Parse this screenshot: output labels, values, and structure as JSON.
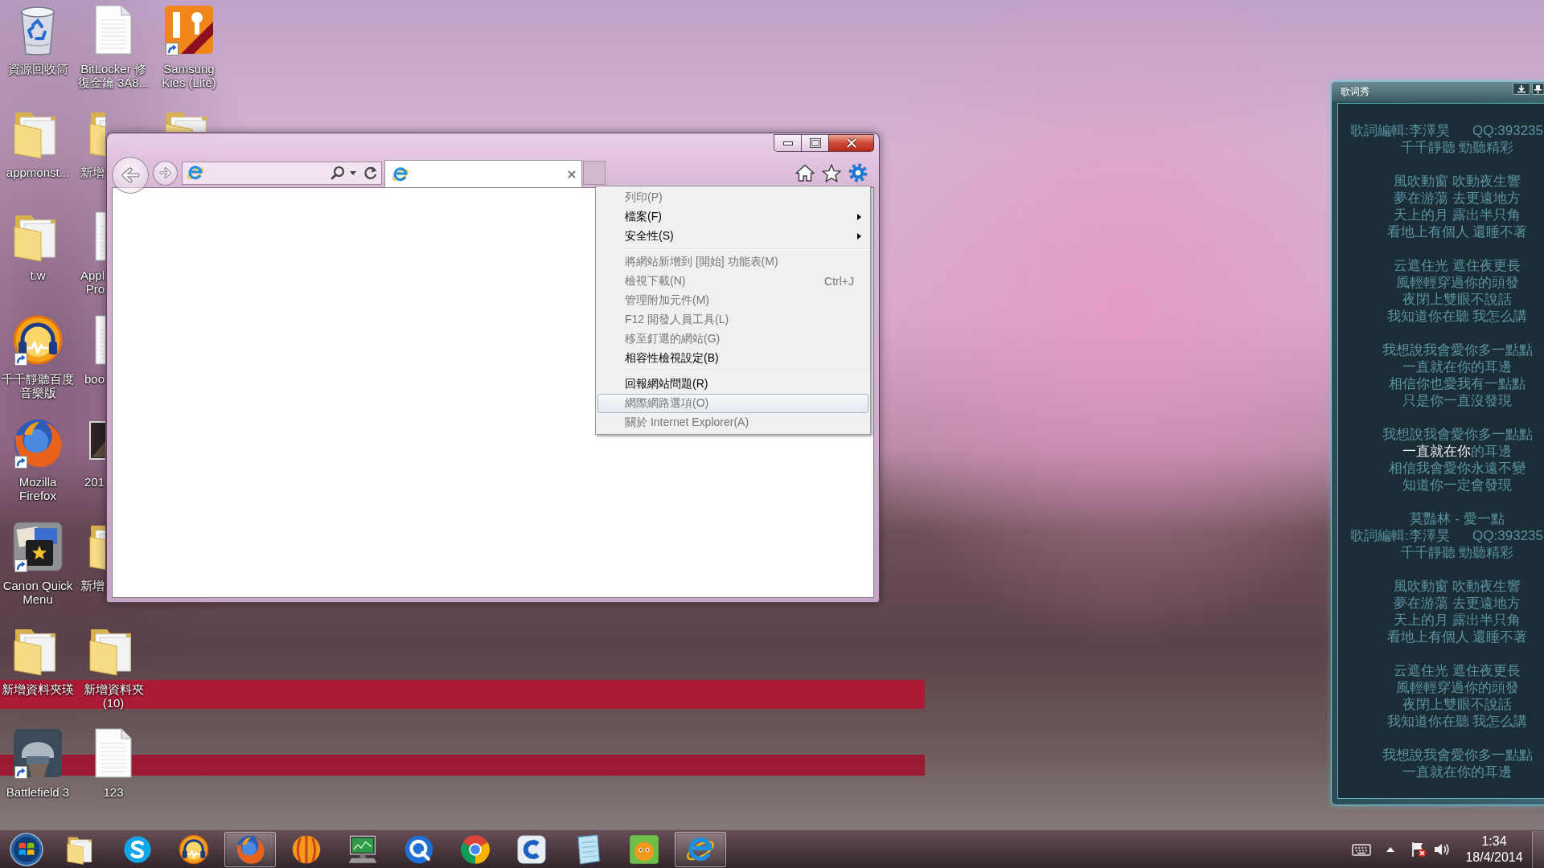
{
  "desktop": {
    "icons": [
      {
        "label": "資源回收筒",
        "kind": "recycle",
        "shortcut": false
      },
      {
        "label": "appmonst...",
        "kind": "folder",
        "shortcut": false
      },
      {
        "label": "t.w",
        "kind": "folder",
        "shortcut": false
      },
      {
        "label": "千千靜聽百度音樂版",
        "kind": "player",
        "shortcut": true
      },
      {
        "label": "Mozilla Firefox",
        "kind": "firefox",
        "shortcut": true
      },
      {
        "label": "Canon Quick Menu",
        "kind": "canon",
        "shortcut": true
      },
      {
        "label": "新增資料夾瑛",
        "kind": "folder",
        "shortcut": false
      },
      {
        "label": "Battlefield 3",
        "kind": "game",
        "shortcut": true
      },
      {
        "label": "BitLocker 修復金鑰 3A8...",
        "kind": "document",
        "shortcut": false
      },
      {
        "label": "新增",
        "kind": "folder",
        "shortcut": false
      },
      {
        "label": "Appl Pro",
        "kind": "document",
        "shortcut": false
      },
      {
        "label": "boo",
        "kind": "document",
        "shortcut": false
      },
      {
        "label": "201",
        "kind": "photo",
        "shortcut": false
      },
      {
        "label": "新增",
        "kind": "folder",
        "shortcut": false
      },
      {
        "label": "新增資料夾 (10)",
        "kind": "folder",
        "shortcut": false
      },
      {
        "label": "123",
        "kind": "document",
        "shortcut": false
      },
      {
        "label": "Samsung Kies (Lite)",
        "kind": "kies",
        "shortcut": true
      },
      {
        "kind": "folder",
        "shortcut": false
      }
    ]
  },
  "browser": {
    "tabs": [
      {
        "selected": true
      }
    ],
    "menu": [
      {
        "kind": "item",
        "label": "列印(P)",
        "disabled": true,
        "highlighted": false,
        "submenu": false
      },
      {
        "kind": "item",
        "label": "檔案(F)",
        "disabled": false,
        "highlighted": false,
        "submenu": true
      },
      {
        "kind": "item",
        "label": "安全性(S)",
        "disabled": false,
        "highlighted": false,
        "submenu": true
      },
      {
        "kind": "separator"
      },
      {
        "kind": "item",
        "label": "將網站新增到 [開始] 功能表(M)",
        "disabled": true,
        "highlighted": false,
        "submenu": false
      },
      {
        "kind": "item",
        "label": "檢視下載(N)",
        "shortcut": "Ctrl+J",
        "disabled": true,
        "highlighted": false,
        "submenu": false
      },
      {
        "kind": "item",
        "label": "管理附加元件(M)",
        "disabled": true,
        "highlighted": false,
        "submenu": false
      },
      {
        "kind": "item",
        "label": "F12 開發人員工具(L)",
        "disabled": true,
        "highlighted": false,
        "submenu": false
      },
      {
        "kind": "item",
        "label": "移至釘選的網站(G)",
        "disabled": true,
        "highlighted": false,
        "submenu": false
      },
      {
        "kind": "item",
        "label": "相容性檢視設定(B)",
        "disabled": false,
        "highlighted": false,
        "submenu": false
      },
      {
        "kind": "separator"
      },
      {
        "kind": "item",
        "label": "回報網站問題(R)",
        "disabled": false,
        "highlighted": false,
        "submenu": false
      },
      {
        "kind": "item",
        "label": "網際網路選項(O)",
        "disabled": true,
        "highlighted": true,
        "submenu": false
      },
      {
        "kind": "item",
        "label": "關於 Internet Explorer(A)",
        "disabled": true,
        "highlighted": false,
        "submenu": false
      }
    ]
  },
  "lyrics_window": {
    "title": "歌词秀",
    "stanzas": [
      [
        {
          "parts": [
            "歌詞編輯:李澤昊",
            "QQ:393235"
          ]
        },
        {
          "text": "千千靜聽 勁聽精彩"
        }
      ],
      [
        {
          "text": "風吹動窗 吹動夜生響"
        },
        {
          "text": "夢在游蕩 去更遠地方"
        },
        {
          "text": "天上的月 露出半只角"
        },
        {
          "text": "看地上有個人 還睡不著"
        }
      ],
      [
        {
          "text": "云遮住光 遮住夜更長"
        },
        {
          "text": "風輕輕穿過你的頭發"
        },
        {
          "text": "夜閉上雙眼不說話"
        },
        {
          "text": "我知道你在聽 我怎么講"
        }
      ],
      [
        {
          "text": "我想說我會愛你多一點點"
        },
        {
          "text": "一直就在你的耳邊"
        },
        {
          "text": "相信你也愛我有一點點"
        },
        {
          "text": "只是你一直沒發現"
        }
      ],
      [
        {
          "text": "我想說我會愛你多一點點"
        },
        {
          "text": "一直就在你的耳邊",
          "level": 0.63
        },
        {
          "text": "相信我會愛你永遠不變"
        },
        {
          "text": "知道你一定會發現"
        }
      ],
      [
        {
          "text": "莫豔林 - 愛一點"
        },
        {
          "parts": [
            "歌詞編輯:李澤昊",
            "QQ:393235"
          ]
        },
        {
          "text": "千千靜聽 勁聽精彩"
        }
      ],
      [
        {
          "text": "風吹動窗 吹動夜生響"
        },
        {
          "text": "夢在游蕩 去更遠地方"
        },
        {
          "text": "天上的月 露出半只角"
        },
        {
          "text": "看地上有個人 還睡不著"
        }
      ],
      [
        {
          "text": "云遮住光 遮住夜更長"
        },
        {
          "text": "風輕輕穿過你的頭發"
        },
        {
          "text": "夜閉上雙眼不說話"
        },
        {
          "text": "我知道你在聽 我怎么講"
        }
      ],
      [
        {
          "text": "我想說我會愛你多一點點"
        },
        {
          "text": "一直就在你的耳邊"
        }
      ]
    ]
  },
  "taskbar": {
    "buttons": [
      {
        "kind": "folder",
        "running": false
      },
      {
        "kind": "skype",
        "running": false
      },
      {
        "kind": "player",
        "running": false
      },
      {
        "kind": "firefox",
        "running": true
      },
      {
        "kind": "ball",
        "running": false
      },
      {
        "kind": "monitor",
        "running": false
      },
      {
        "kind": "swirl",
        "running": false
      },
      {
        "kind": "chrome",
        "running": false
      },
      {
        "kind": "ctile",
        "running": false
      },
      {
        "kind": "pad",
        "running": false
      },
      {
        "kind": "cartoon",
        "running": false
      },
      {
        "kind": "ie",
        "running": true
      }
    ],
    "clock": {
      "time": "1:34",
      "date": "18/4/2014"
    }
  }
}
